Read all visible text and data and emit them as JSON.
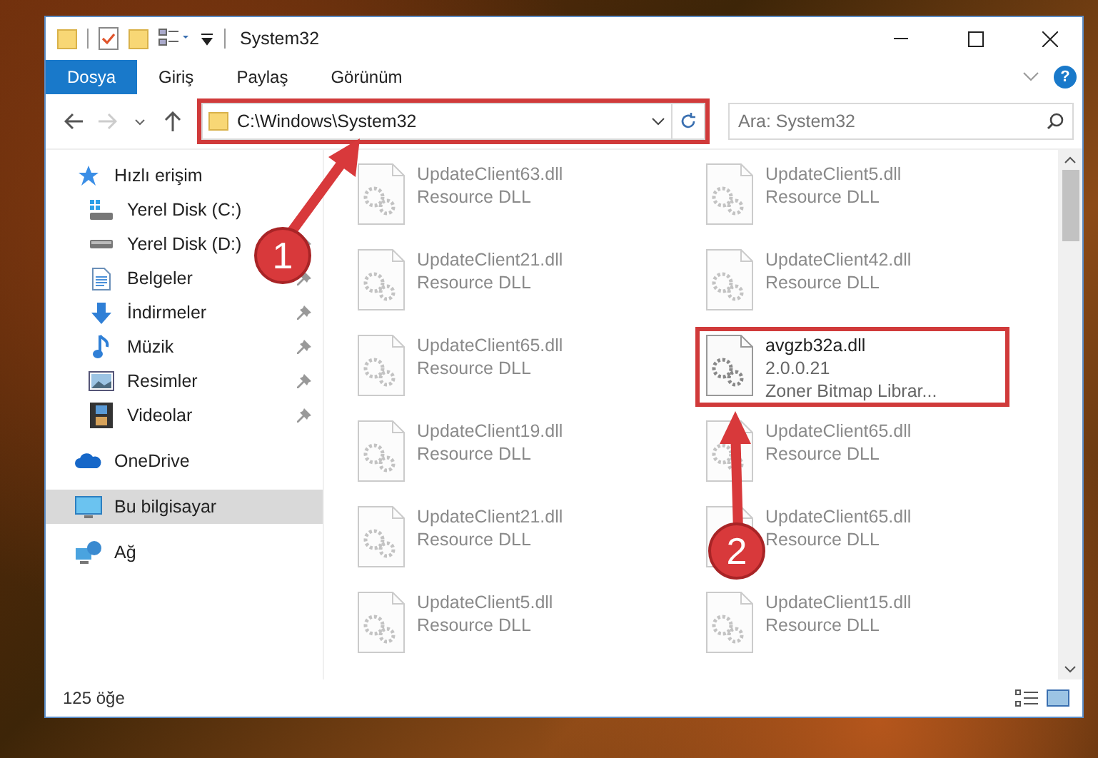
{
  "window": {
    "title": "System32"
  },
  "ribbon": {
    "tabs": [
      {
        "label": "Dosya",
        "selected": true
      },
      {
        "label": "Giriş",
        "selected": false
      },
      {
        "label": "Paylaş",
        "selected": false
      },
      {
        "label": "Görünüm",
        "selected": false
      }
    ],
    "help_label": "?"
  },
  "address_bar": {
    "path": "C:\\Windows\\System32",
    "highlighted": true
  },
  "search": {
    "placeholder": "Ara: System32"
  },
  "sidebar": {
    "items": [
      {
        "label": "Hızlı erişim",
        "kind": "star",
        "selected": false,
        "children": [
          {
            "label": "Yerel Disk (C:)",
            "kind": "drive-win",
            "pinned": false,
            "selected": false
          },
          {
            "label": "Yerel Disk (D:)",
            "kind": "drive",
            "pinned": true,
            "selected": false
          },
          {
            "label": "Belgeler",
            "kind": "document",
            "pinned": true,
            "selected": false
          },
          {
            "label": "İndirmeler",
            "kind": "download",
            "pinned": true,
            "selected": false
          },
          {
            "label": "Müzik",
            "kind": "music",
            "pinned": true,
            "selected": false
          },
          {
            "label": "Resimler",
            "kind": "picture",
            "pinned": true,
            "selected": false
          },
          {
            "label": "Videolar",
            "kind": "film",
            "pinned": true,
            "selected": false
          }
        ]
      },
      {
        "label": "OneDrive",
        "kind": "cloud",
        "selected": false
      },
      {
        "label": "Bu bilgisayar",
        "kind": "monitor",
        "selected": true
      },
      {
        "label": "Ağ",
        "kind": "network",
        "selected": false
      }
    ]
  },
  "files": [
    {
      "name": "UpdateClient63.dll",
      "lines": [
        "Resource DLL"
      ],
      "kind": "faded",
      "highlighted": false
    },
    {
      "name": "UpdateClient5.dll",
      "lines": [
        "Resource DLL"
      ],
      "kind": "faded",
      "highlighted": false
    },
    {
      "name": "UpdateClient21.dll",
      "lines": [
        "Resource DLL"
      ],
      "kind": "faded",
      "highlighted": false
    },
    {
      "name": "UpdateClient42.dll",
      "lines": [
        "Resource DLL"
      ],
      "kind": "faded",
      "highlighted": false
    },
    {
      "name": "UpdateClient65.dll",
      "lines": [
        "Resource DLL"
      ],
      "kind": "faded",
      "highlighted": false
    },
    {
      "name": "avgzb32a.dll",
      "lines": [
        "2.0.0.21",
        "Zoner Bitmap Librar..."
      ],
      "kind": "normal",
      "highlighted": true
    },
    {
      "name": "UpdateClient19.dll",
      "lines": [
        "Resource DLL"
      ],
      "kind": "faded",
      "highlighted": false
    },
    {
      "name": "UpdateClient65.dll",
      "lines": [
        "Resource DLL"
      ],
      "kind": "faded",
      "highlighted": false
    },
    {
      "name": "UpdateClient21.dll",
      "lines": [
        "Resource DLL"
      ],
      "kind": "faded",
      "highlighted": false
    },
    {
      "name": "UpdateClient65.dll",
      "lines": [
        "Resource DLL"
      ],
      "kind": "faded",
      "highlighted": false
    },
    {
      "name": "UpdateClient5.dll",
      "lines": [
        "Resource DLL"
      ],
      "kind": "faded",
      "highlighted": false
    },
    {
      "name": "UpdateClient15.dll",
      "lines": [
        "Resource DLL"
      ],
      "kind": "faded",
      "highlighted": false
    }
  ],
  "status_bar": {
    "item_count": "125 öğe"
  },
  "annotations": [
    {
      "label": "1"
    },
    {
      "label": "2"
    }
  ]
}
